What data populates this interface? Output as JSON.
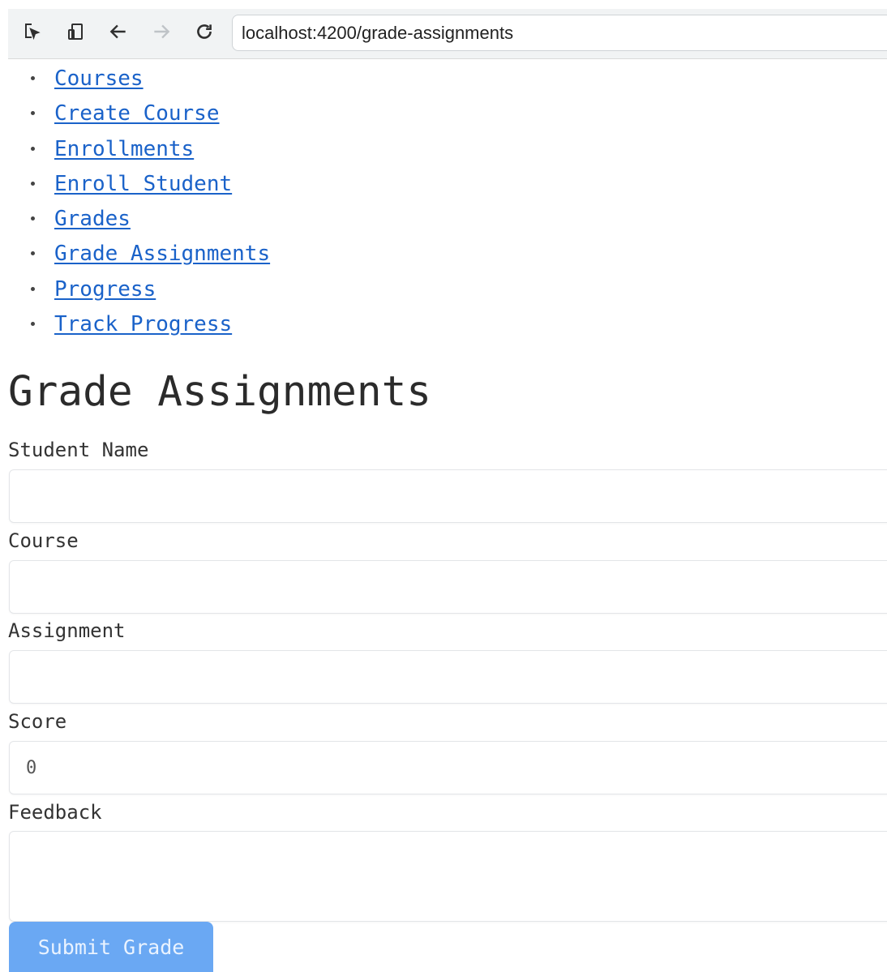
{
  "browser": {
    "icons": [
      "inspect-icon",
      "device-toggle-icon",
      "back-arrow-icon",
      "forward-arrow-icon",
      "reload-icon"
    ],
    "url": "localhost:4200/grade-assignments"
  },
  "nav": {
    "items": [
      {
        "label": "Courses"
      },
      {
        "label": "Create Course"
      },
      {
        "label": "Enrollments"
      },
      {
        "label": "Enroll Student"
      },
      {
        "label": "Grades"
      },
      {
        "label": "Grade Assignments"
      },
      {
        "label": "Progress"
      },
      {
        "label": "Track Progress"
      }
    ]
  },
  "page": {
    "title": "Grade Assignments"
  },
  "form": {
    "student_name": {
      "label": "Student Name",
      "value": ""
    },
    "course": {
      "label": "Course",
      "value": ""
    },
    "assignment": {
      "label": "Assignment",
      "value": ""
    },
    "score": {
      "label": "Score",
      "value": "0"
    },
    "feedback": {
      "label": "Feedback",
      "value": ""
    },
    "submit_label": "Submit Grade"
  },
  "colors": {
    "link": "#1a62c9",
    "submit_button": "#6aa8f3"
  }
}
